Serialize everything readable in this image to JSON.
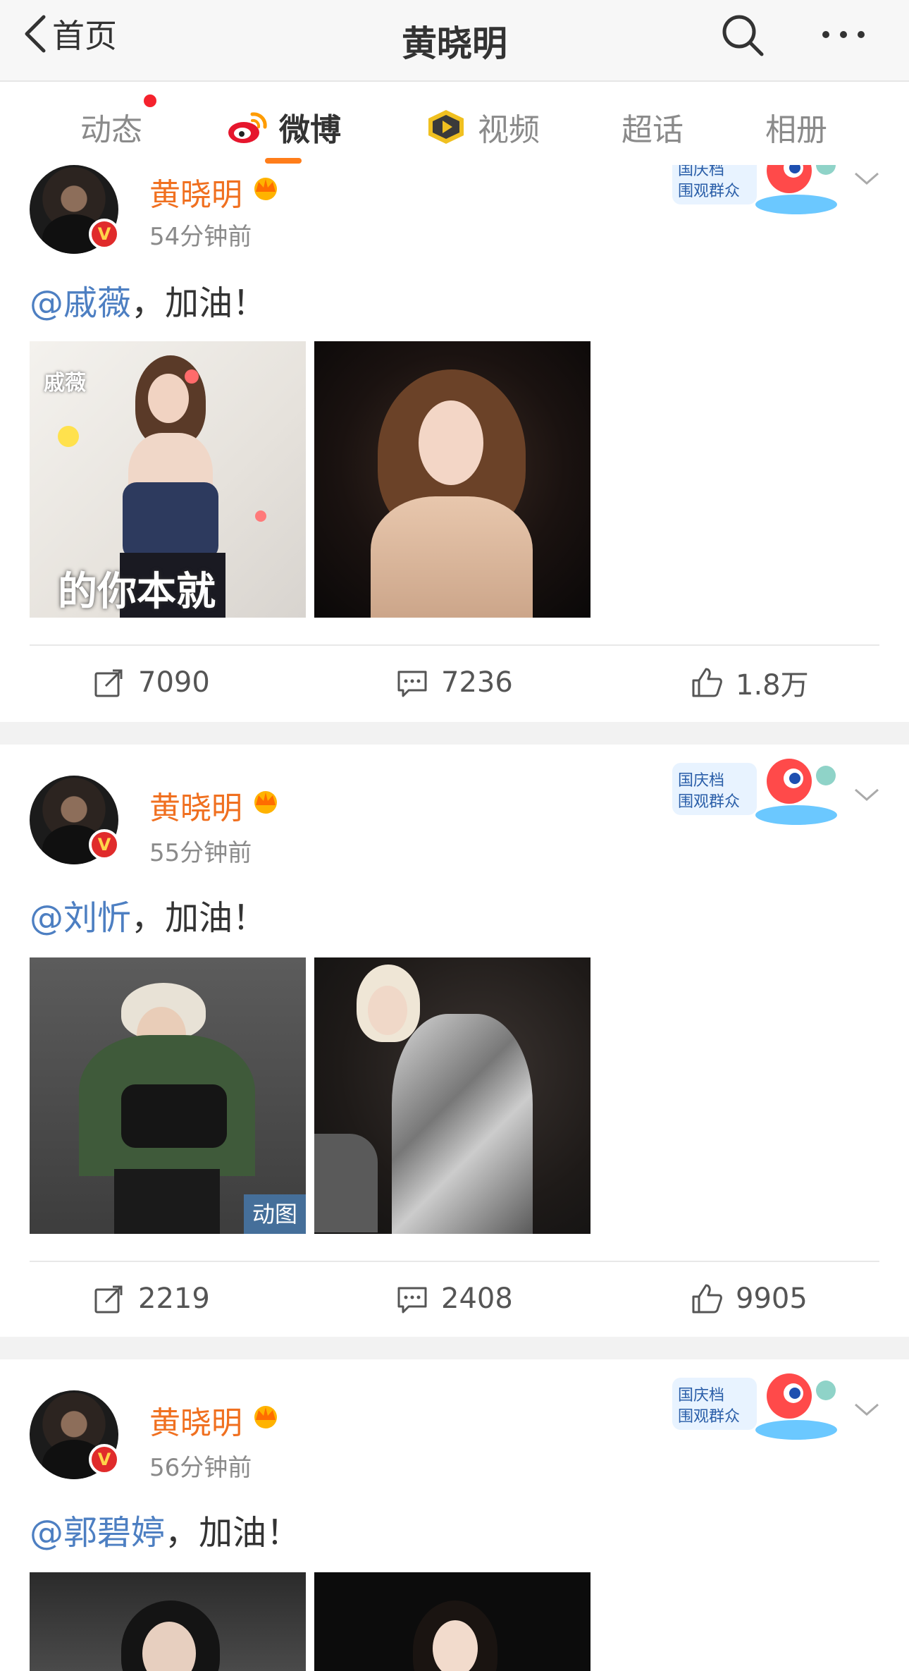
{
  "nav": {
    "back_label": "首页",
    "title": "黄晓明",
    "search_icon": "search-icon",
    "more_icon": "more-icon"
  },
  "tabs": [
    {
      "label": "动态",
      "has_dot": true
    },
    {
      "label": "微博",
      "icon": "weibo-logo-icon",
      "active": true
    },
    {
      "label": "视频",
      "icon": "video-play-icon"
    },
    {
      "label": "超话"
    },
    {
      "label": "相册"
    }
  ],
  "colors": {
    "accent": "#ff7d1a",
    "username": "#f07020",
    "mention": "#4d7fc2",
    "verified": "#e02b2b"
  },
  "badge_text": {
    "line1": "国庆档",
    "line2": "围观群众"
  },
  "posts": [
    {
      "username": "黄晓明",
      "time": "54分钟前",
      "mention": "@戚薇",
      "text": "，加油！",
      "image1_text": "戚薇",
      "image1_caption": "的你本就",
      "reposts": "7090",
      "comments": "7236",
      "likes": "1.8万"
    },
    {
      "username": "黄晓明",
      "time": "55分钟前",
      "mention": "@刘忻",
      "text": "，加油！",
      "gif_label": "动图",
      "reposts": "2219",
      "comments": "2408",
      "likes": "9905"
    },
    {
      "username": "黄晓明",
      "time": "56分钟前",
      "mention": "@郭碧婷",
      "text": "，加油！"
    }
  ]
}
